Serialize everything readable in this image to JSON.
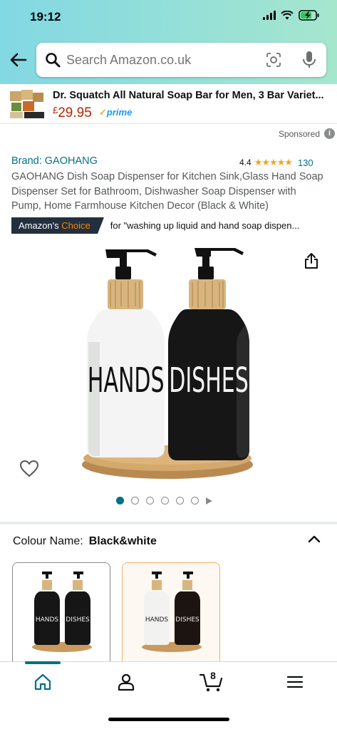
{
  "status_bar": {
    "time": "19:12"
  },
  "search": {
    "placeholder": "Search Amazon.co.uk"
  },
  "ad": {
    "title": "Dr. Squatch All Natural Soap Bar for Men, 3 Bar Variet...",
    "currency": "£",
    "price": "29.95",
    "prime_label": "prime"
  },
  "sponsored_label": "Sponsored",
  "product": {
    "brand": "Brand: GAOHANG",
    "rating": "4.4",
    "stars": "★★★★★",
    "rating_count": "130",
    "title": "GAOHANG Dish Soap Dispenser for Kitchen Sink,Glass Hand Soap Dispenser Set for Bathroom, Dishwasher Soap Dispenser with Pump, Home Farmhouse Kitchen Decor (Black & White)",
    "badge_prefix": "Amazon's ",
    "badge_highlight": "Choice",
    "badge_text": "for \"washing up liquid and hand soap dispen...",
    "bottle_labels": [
      "HANDS",
      "DISHES"
    ],
    "image_count": 6,
    "active_image": 1
  },
  "variation": {
    "label": "Colour Name:",
    "value": "Black&white",
    "swatch_labels": [
      "HANDS",
      "DISHES",
      "HANDS",
      "DISHES"
    ]
  },
  "bottom_nav": {
    "cart_count": "8"
  },
  "colors": {
    "accent_teal": "#007185",
    "price_red": "#b12704",
    "prime_blue": "#1a98ff",
    "badge_navy": "#232f3e",
    "badge_orange": "#f08804",
    "star_orange": "#f4a51c"
  }
}
